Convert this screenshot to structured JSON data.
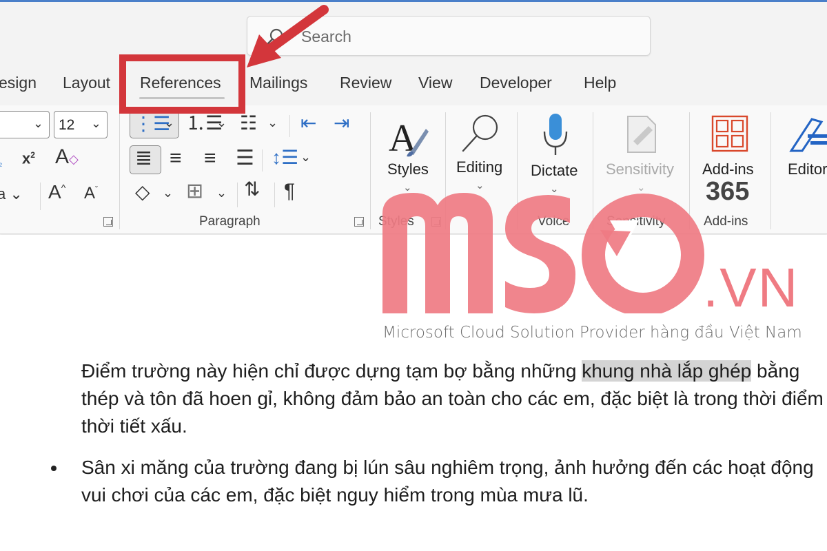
{
  "search": {
    "placeholder": "Search"
  },
  "tabs": [
    {
      "label": "esign"
    },
    {
      "label": "Layout"
    },
    {
      "label": "References"
    },
    {
      "label": "Mailings"
    },
    {
      "label": "Review"
    },
    {
      "label": "View"
    },
    {
      "label": "Developer"
    },
    {
      "label": "Help"
    }
  ],
  "font": {
    "size_value": "12"
  },
  "groups": {
    "paragraph": "Paragraph",
    "styles": "Styles",
    "voice": "Voice",
    "sensitivity": "Sensitivity",
    "addins": "Add-ins"
  },
  "buttons": {
    "styles": "Styles",
    "editing": "Editing",
    "dictate": "Dictate",
    "sensitivity": "Sensitivity",
    "addins": "Add-ins",
    "addins_number": "365",
    "editor": "Editor"
  },
  "document": {
    "para1_pre": "Điểm trường này hiện chỉ được dựng tạm bợ bằng những ",
    "para1_highlight": "khung nhà lắp ghép",
    "para1_post": " bằng thép và tôn đã hoen gỉ, không đảm bảo an toàn cho các em, đặc biệt là trong thời điểm thời tiết xấu.",
    "bullet1": "Sân xi măng của trường đang bị lún sâu nghiêm trọng, ảnh hưởng đến các hoạt động vui chơi của các em, đặc biệt nguy hiểm trong mùa mưa lũ."
  },
  "watermark": {
    "brand": "MSO",
    "domain": ".VN",
    "tagline": "Microsoft Cloud Solution Provider hàng đầu Việt Nam"
  },
  "colors": {
    "annotation_red": "#d3363b",
    "watermark_pink": "#ef7b83",
    "addins_orange": "#d9482b",
    "dictate_blue": "#3a8fd8",
    "editor_blue": "#2364c4"
  }
}
